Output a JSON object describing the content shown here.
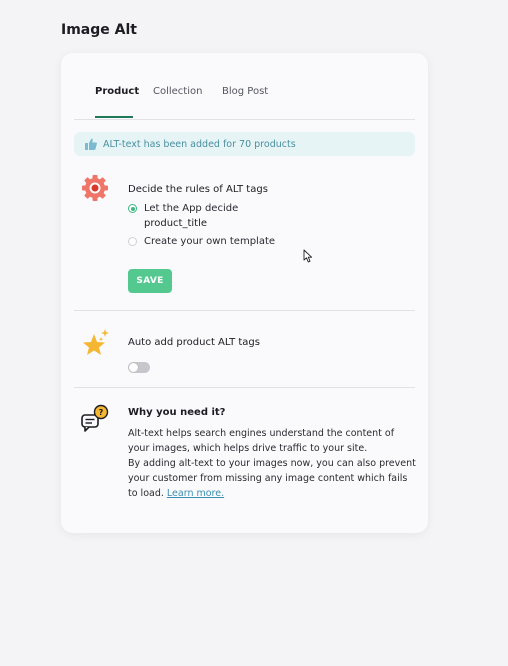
{
  "page": {
    "title": "Image Alt"
  },
  "tabs": [
    {
      "label": "Product",
      "active": true
    },
    {
      "label": "Collection",
      "active": false
    },
    {
      "label": "Blog Post",
      "active": false
    }
  ],
  "banner": {
    "text": "ALT-text has been added for 70 products",
    "icon": "thumbs-up-icon"
  },
  "rules": {
    "title": "Decide the rules of ALT tags",
    "icon": "gear-icon",
    "options": [
      {
        "label": "Let the App decide",
        "selected": true
      },
      {
        "label": "Create your own template",
        "selected": false
      }
    ],
    "selected_value": "product_title",
    "save_label": "SAVE"
  },
  "auto": {
    "title": "Auto add product ALT tags",
    "icon": "star-sparkle-icon",
    "enabled": false
  },
  "why": {
    "title": "Why you need it?",
    "icon": "question-chat-icon",
    "line1": "Alt-text helps search engines understand the content of your images, which helps drive traffic to your site.",
    "line2": "By adding alt-text to your images now, you can also prevent your customer from missing any image content which fails to load.",
    "link": "Learn more."
  },
  "colors": {
    "accent": "#53c990",
    "tab_underline": "#1f7a5a",
    "banner_bg": "#e6f4f6",
    "link": "#3a8fb0"
  }
}
